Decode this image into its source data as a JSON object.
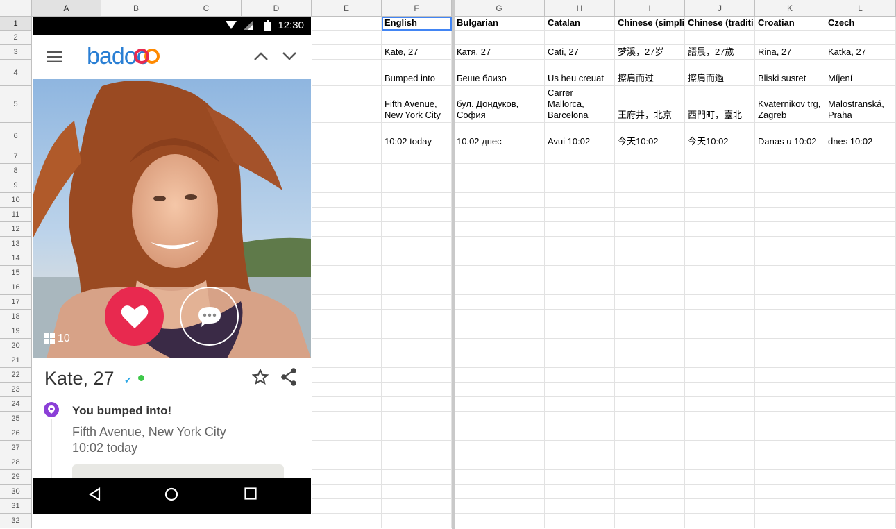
{
  "sheet": {
    "columns": [
      "A",
      "B",
      "C",
      "D",
      "E",
      "F",
      "G",
      "H",
      "I",
      "J",
      "K",
      "L"
    ],
    "rows": [
      "1",
      "2",
      "3",
      "4",
      "5",
      "6",
      "7",
      "8",
      "9",
      "10",
      "11",
      "12",
      "13",
      "14",
      "15",
      "16",
      "17",
      "18",
      "19",
      "20",
      "21",
      "22",
      "23",
      "24",
      "25",
      "26",
      "27",
      "28",
      "29",
      "30",
      "31",
      "32"
    ],
    "languages": [
      {
        "name": "English",
        "name_age": "Kate, 27",
        "bumped": "Bumped into",
        "place": "Fifth Avenue,\nNew York City",
        "time": "10:02 today"
      },
      {
        "name": "Bulgarian",
        "name_age": "Катя, 27",
        "bumped": "Беше близо",
        "place": "бул. Дондуков,\nСофия",
        "time": "10.02 днес"
      },
      {
        "name": "Catalan",
        "name_age": "Cati, 27",
        "bumped": "Us heu creuat",
        "place": "Carrer Mallorca,\nBarcelona",
        "time": "Avui 10:02"
      },
      {
        "name": "Chinese (simplified)",
        "name_age": "梦溪，27岁",
        "bumped": "擦肩而过",
        "place": "王府井，北京",
        "time": "今天10:02"
      },
      {
        "name": "Chinese (traditional)",
        "name_age": "語晨，27歲",
        "bumped": "擦肩而過",
        "place": "西門町，臺北",
        "time": "今天10:02"
      },
      {
        "name": "Croatian",
        "name_age": "Rina, 27",
        "bumped": "Bliski susret",
        "place": "Kvaternikov trg,\nZagreb",
        "time": "Danas u 10:02"
      },
      {
        "name": "Czech",
        "name_age": "Katka, 27",
        "bumped": "Míjení",
        "place": "Malostranská,\nPraha",
        "time": "dnes 10:02"
      }
    ]
  },
  "phone": {
    "status_time": "12:30",
    "brand": "badoo",
    "photo_count": "10",
    "profile_name": "Kate, 27",
    "bumped_title": "You bumped into!",
    "bumped_place": "Fifth Avenue, New York City",
    "bumped_time": "10:02 today",
    "icons": [
      "menu-icon",
      "chevron-up-icon",
      "chevron-down-icon",
      "heart-icon",
      "chat-icon",
      "photos-icon",
      "verified-icon",
      "star-icon",
      "share-icon",
      "location-pin-icon",
      "back-icon",
      "home-icon",
      "recents-icon"
    ],
    "colors": {
      "like": "#e8294f",
      "pin": "#8b3fd7",
      "online": "#3ec84a",
      "verified": "#2ea8e6"
    }
  }
}
